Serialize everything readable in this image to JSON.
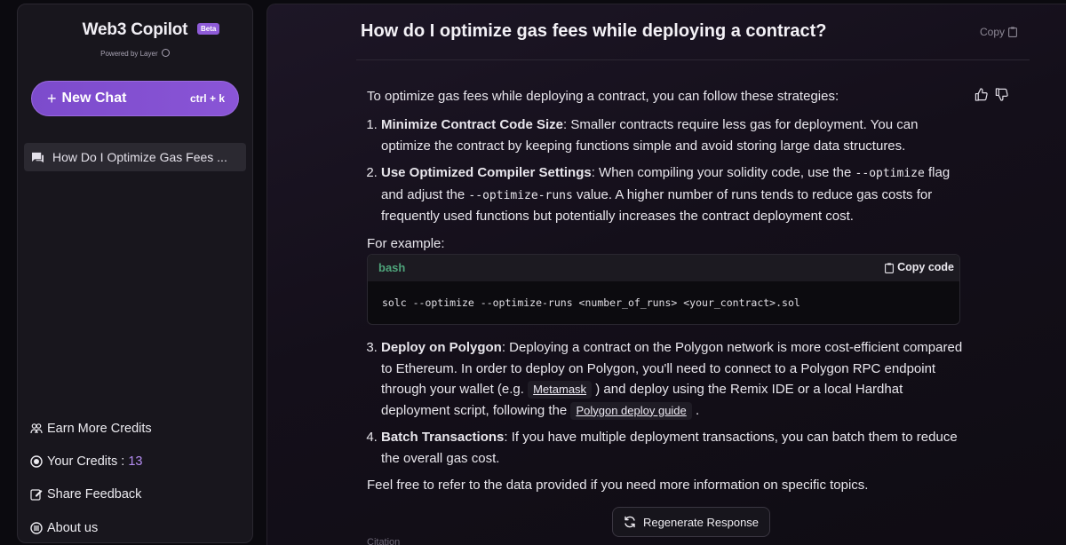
{
  "brand": {
    "title": "Web3 Copilot",
    "badge": "Beta",
    "powered": "Powered by Layer"
  },
  "sidebar": {
    "new_chat": {
      "label": "New Chat",
      "shortcut": "ctrl + k"
    },
    "history": [
      {
        "title": "How Do I Optimize Gas Fees ..."
      }
    ],
    "links": {
      "earn": "Earn More Credits",
      "credits_label": "Your Credits :",
      "credits_value": "13",
      "feedback": "Share Feedback",
      "about": "About us"
    }
  },
  "main": {
    "question": "How do I optimize gas fees while deploying a contract?",
    "copy_label": "Copy",
    "answer": {
      "intro": "To optimize gas fees while deploying a contract, you can follow these strategies:",
      "items": [
        {
          "title": "Minimize Contract Code Size",
          "text": ": Smaller contracts require less gas for deployment. You can optimize the contract by keeping functions simple and avoid storing large data structures."
        },
        {
          "title": "Use Optimized Compiler Settings",
          "text_a": ": When compiling your solidity code, use the ",
          "code_a": "--optimize",
          "text_b": " flag and adjust the ",
          "code_b": "--optimize-runs",
          "text_c": " value. A higher number of runs tends to reduce gas costs for frequently used functions but potentially increases the contract deployment cost."
        },
        {
          "title": "Deploy on Polygon",
          "text_a": ": Deploying a contract on the Polygon network is more cost-efficient compared to Ethereum. In order to deploy on Polygon, you'll need to connect to a Polygon RPC endpoint through your wallet (e.g. ",
          "link_a": "Metamask",
          "text_b": " ) and deploy using the Remix IDE or a local Hardhat deployment script, following the ",
          "link_b": "Polygon deploy guide",
          "text_c": " ."
        },
        {
          "title": "Batch Transactions",
          "text": ": If you have multiple deployment transactions, you can batch them to reduce the overall gas cost."
        }
      ],
      "example_label": "For example:",
      "code": {
        "lang": "bash",
        "copy_label": "Copy code",
        "content": "solc --optimize --optimize-runs <number_of_runs> <your_contract>.sol"
      },
      "closing": "Feel free to refer to the data provided if you need more information on specific topics.",
      "citation": "Citation"
    },
    "regenerate": "Regenerate Response"
  }
}
